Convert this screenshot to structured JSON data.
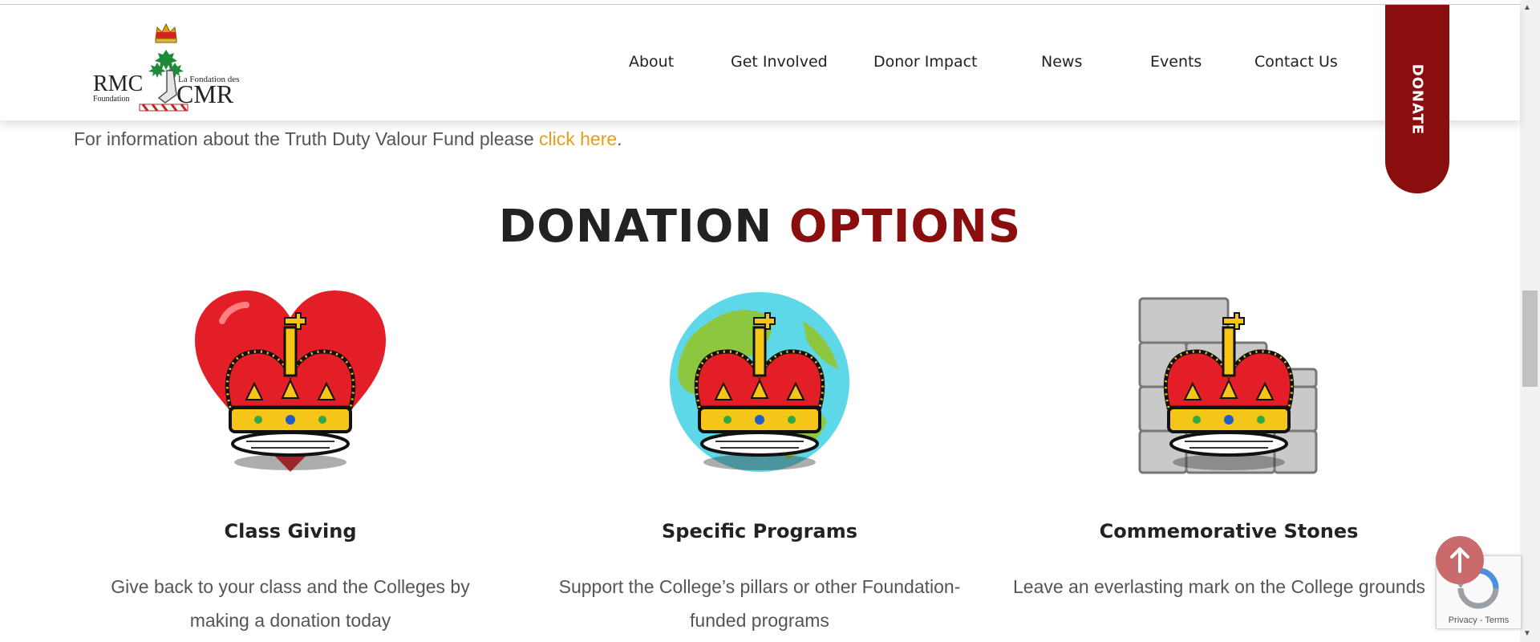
{
  "header": {
    "logo": {
      "text_left": "RMC",
      "text_left_sub": "Foundation",
      "text_right_top": "La Fondation des",
      "text_right": "CMR"
    },
    "nav": [
      "About",
      "Get Involved",
      "Donor Impact",
      "News",
      "Events",
      "Contact Us"
    ],
    "donate_label": "DONATE"
  },
  "info": {
    "text": "For information about the Truth Duty Valour Fund please ",
    "link": "click here",
    "end": "."
  },
  "section": {
    "title_part1": "DONATION",
    "title_part2": "OPTIONS",
    "accent_color": "#8a0e0e"
  },
  "cards": [
    {
      "icon": "crown-heart-icon",
      "title": "Class Giving",
      "desc": "Give back to your class and the Colleges by making a donation today"
    },
    {
      "icon": "crown-globe-icon",
      "title": "Specific Programs",
      "desc": "Support the College’s pillars or other Foundation-funded programs"
    },
    {
      "icon": "crown-stones-icon",
      "title": "Commemorative Stones",
      "desc": "Leave an everlasting mark on the College grounds"
    }
  ],
  "recaptcha": {
    "terms": "Privacy - Terms"
  }
}
